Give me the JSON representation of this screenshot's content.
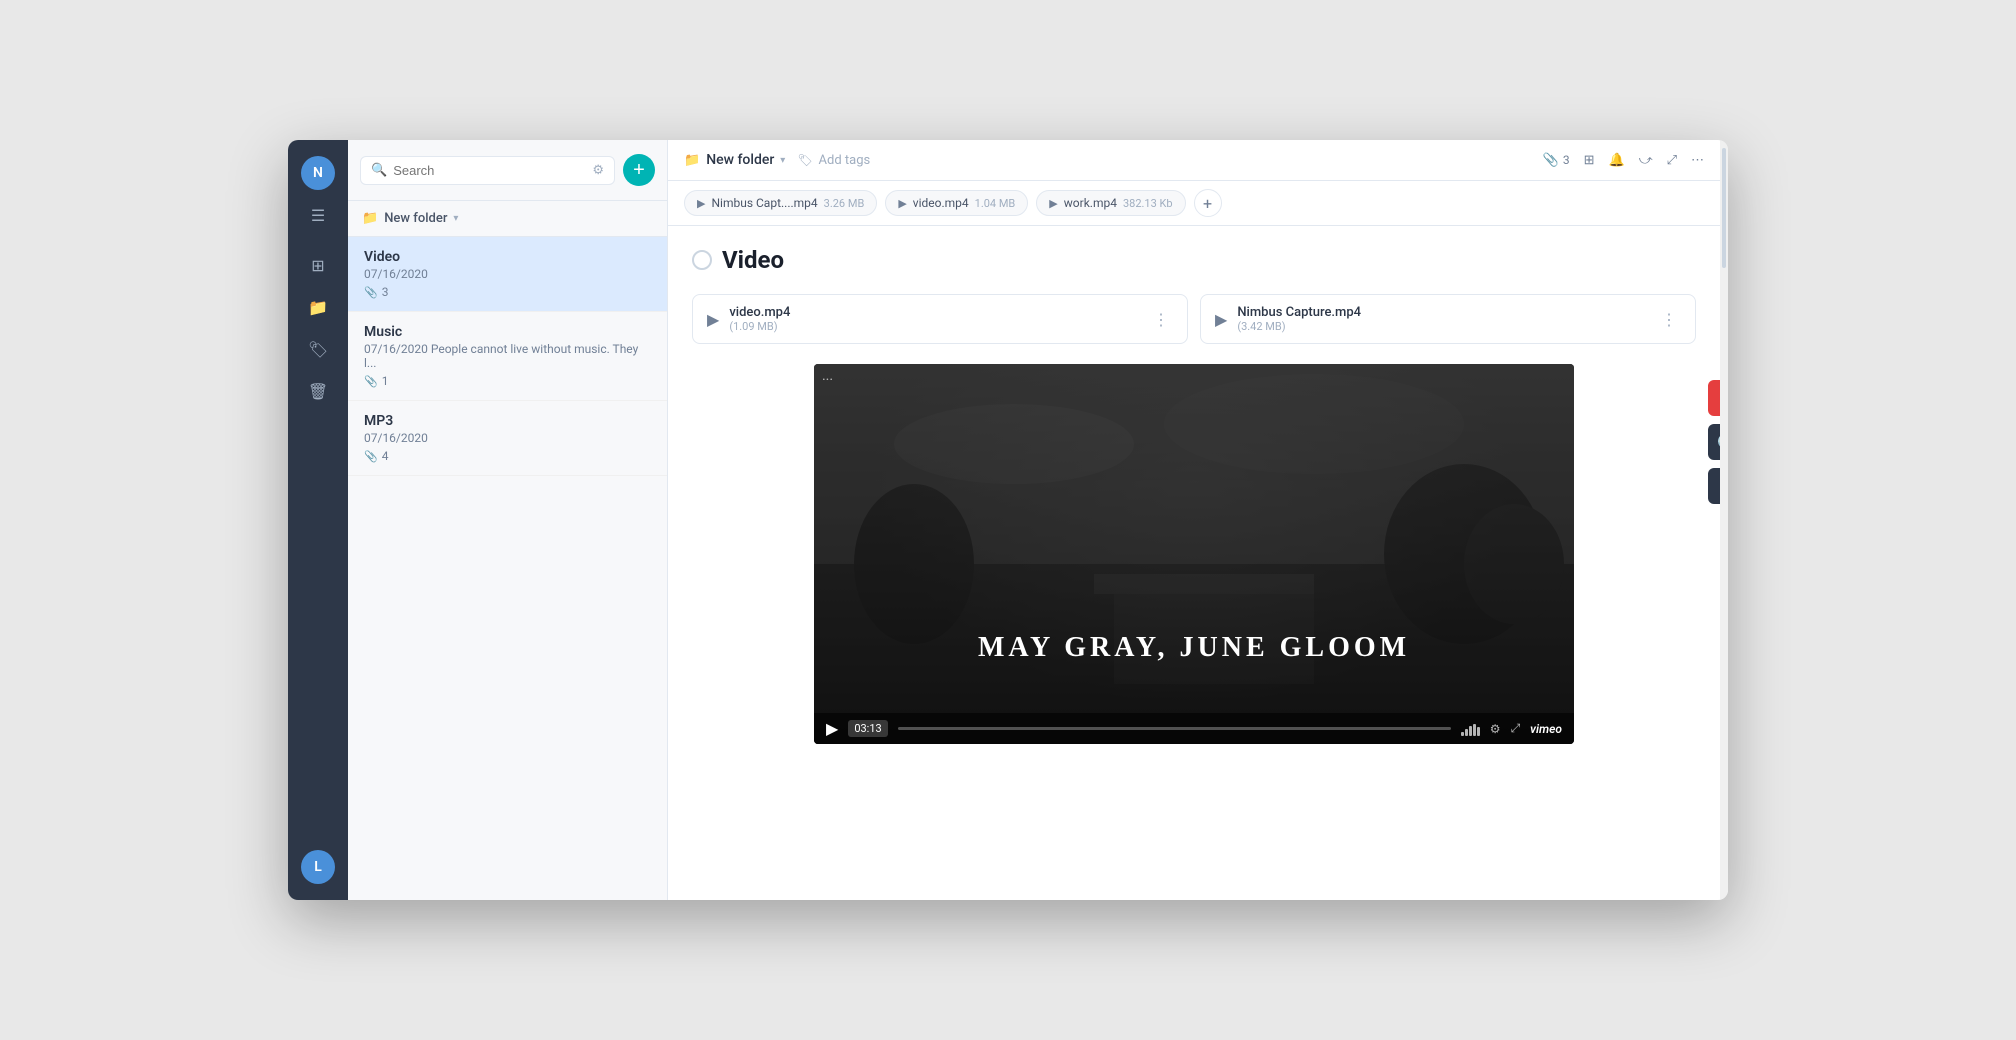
{
  "sidebar_icons": {
    "user_initial": "N",
    "user_initial_bottom": "L"
  },
  "search": {
    "placeholder": "Search",
    "filter_label": "filter",
    "search_label": "search"
  },
  "folder": {
    "name": "New folder",
    "caret": "▾"
  },
  "notes": [
    {
      "id": "video",
      "title": "Video",
      "date": "07/16/2020",
      "preview": "",
      "attachments": "3",
      "active": true
    },
    {
      "id": "music",
      "title": "Music",
      "date": "07/16/2020",
      "preview": "People cannot live without music. They l...",
      "attachments": "1",
      "active": false
    },
    {
      "id": "mp3",
      "title": "MP3",
      "date": "07/16/2020",
      "preview": "",
      "attachments": "4",
      "active": false
    }
  ],
  "main_header": {
    "folder_name": "New folder",
    "add_tags_label": "Add tags",
    "attachment_count": "3",
    "more_label": "..."
  },
  "tabs": [
    {
      "id": "tab1",
      "name": "Nimbus Capt....mp4",
      "size": "3.26 MB"
    },
    {
      "id": "tab2",
      "name": "video.mp4",
      "size": "1.04 MB"
    },
    {
      "id": "tab3",
      "name": "work.mp4",
      "size": "382.13 Kb"
    }
  ],
  "note_content": {
    "title": "Video",
    "files": [
      {
        "id": "f1",
        "name": "video.mp4",
        "size": "(1.09 MB)"
      },
      {
        "id": "f2",
        "name": "Nimbus Capture.mp4",
        "size": "(3.42 MB)"
      }
    ]
  },
  "video": {
    "title": "MAY GRAY, JUNE GLOOM",
    "time": "03:13",
    "three_dots": "...",
    "vimeo_label": "vimeo"
  },
  "side_buttons": {
    "heart": "♥",
    "clock": "🕐",
    "send": "➤"
  }
}
